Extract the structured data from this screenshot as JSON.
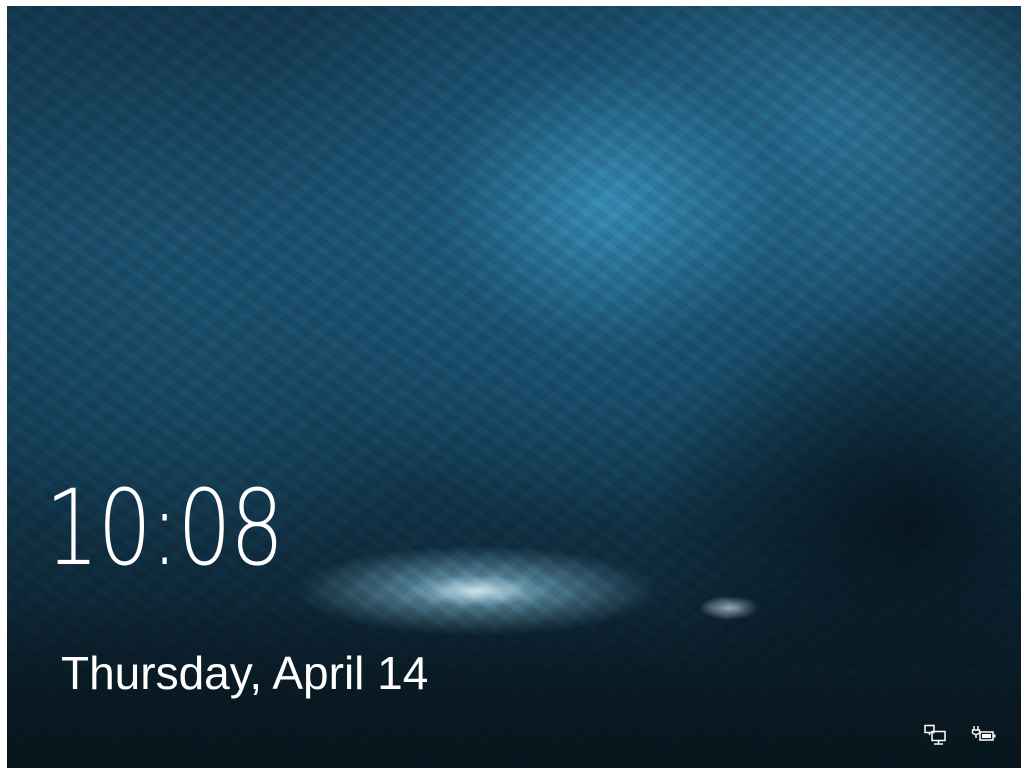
{
  "lock_screen": {
    "time": "10:08",
    "date": "Thursday, April 14"
  },
  "status_icons": [
    {
      "icon": "network-icon"
    },
    {
      "icon": "battery-charging-icon"
    }
  ],
  "colors": {
    "text": "#ffffff",
    "background_dark": "#0b1d28",
    "background_accent": "#3c96be"
  }
}
